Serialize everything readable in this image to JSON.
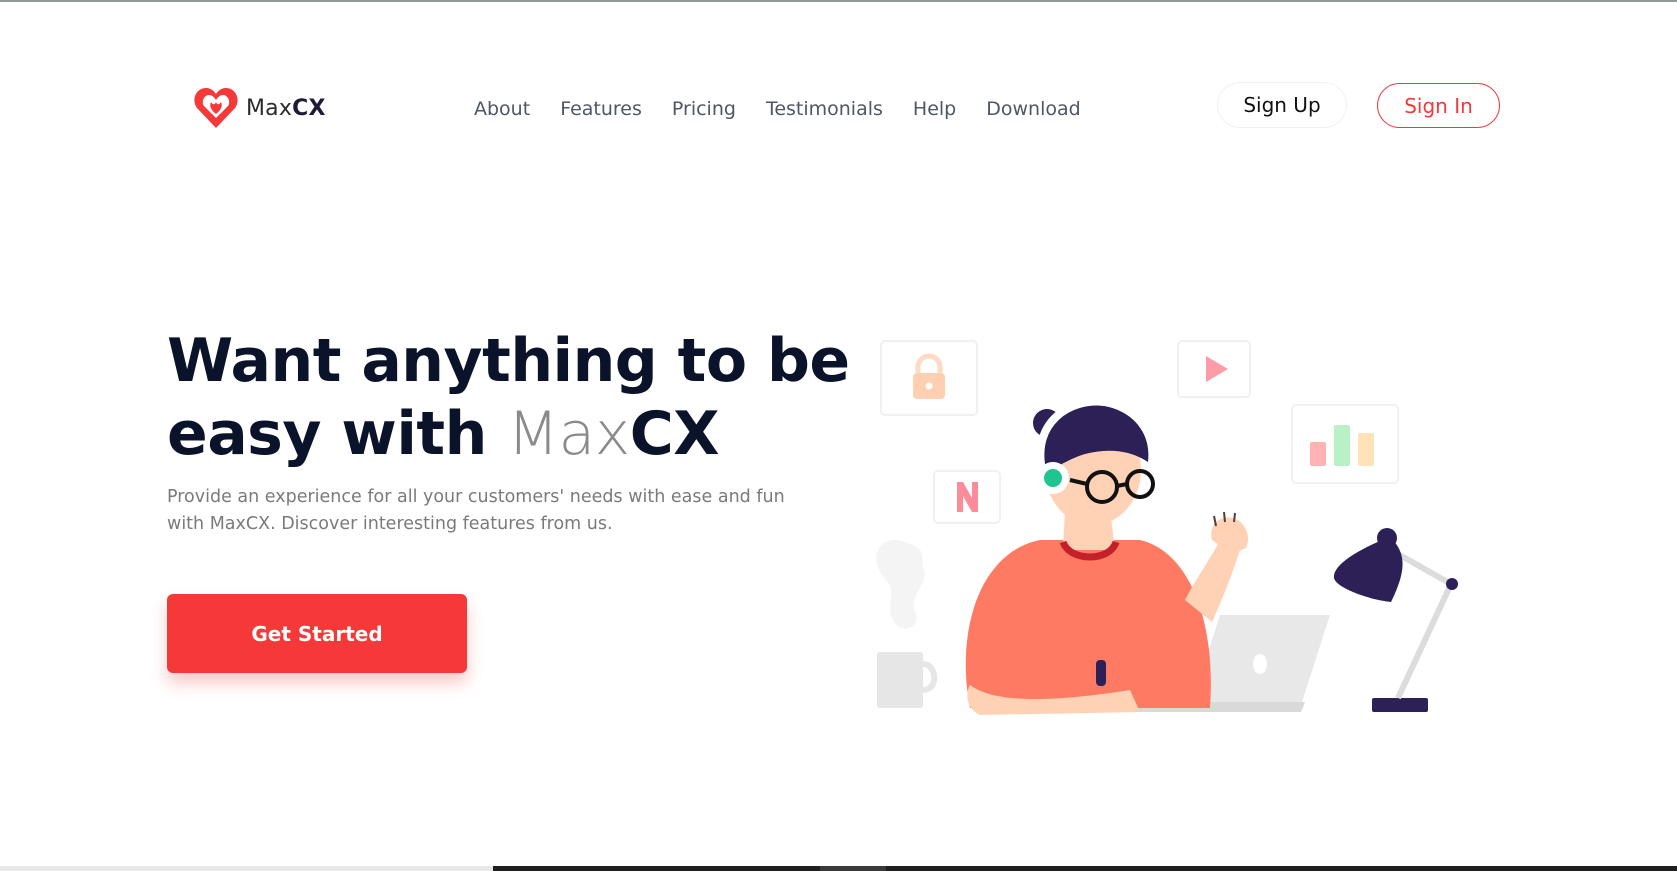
{
  "brand": {
    "name_light": "Max",
    "name_bold": "CX",
    "accent_color": "#f53838",
    "dark_color": "#0b132a"
  },
  "nav": {
    "items": [
      "About",
      "Features",
      "Pricing",
      "Testimonials",
      "Help",
      "Download"
    ]
  },
  "auth": {
    "signup_label": "Sign Up",
    "signin_label": "Sign In"
  },
  "hero": {
    "title_line1": "Want anything to be",
    "title_line2_prefix": "easy with ",
    "title_brand_light": "Max",
    "title_brand_bold": "CX",
    "description": "Provide an experience for all your customers' needs with ease and fun with MaxCX. Discover interesting features from us.",
    "cta_label": "Get Started"
  },
  "illustration": {
    "icons": [
      "lock-icon",
      "play-icon",
      "bar-chart-icon",
      "netflix-icon"
    ],
    "card_letter": "N"
  }
}
